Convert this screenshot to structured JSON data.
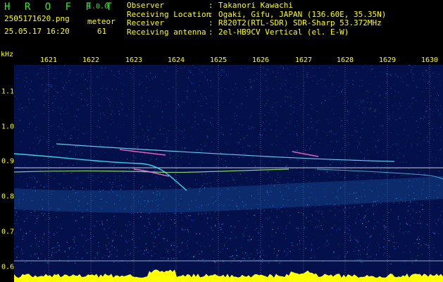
{
  "app": {
    "title": "H R O F F T",
    "version": "1.0.0"
  },
  "capture": {
    "filename": "2505171620.png",
    "datetime": "25.05.17 16:20",
    "meteor_label": "meteor",
    "meteor_count": "61"
  },
  "info": [
    {
      "key": "Observer",
      "sep": ":",
      "value": "Takanori Kawachi"
    },
    {
      "key": "Receiving Location",
      "sep": ":",
      "value": "Ogaki, Gifu, JAPAN (136.60E, 35.35N)"
    },
    {
      "key": "Receiver",
      "sep": ":",
      "value": "R820T2(RTL-SDR) SDR-Sharp 53.372MHz"
    },
    {
      "key": "Receiving antenna",
      "sep": ":",
      "value": "2el-HB9CV Vertical (el. E-W)"
    }
  ],
  "axis": {
    "y_unit": "kHz",
    "x_ticks": [
      "1621",
      "1622",
      "1623",
      "1624",
      "1625",
      "1626",
      "1627",
      "1628",
      "1629",
      "1630"
    ],
    "y_ticks": [
      "1.1",
      "1.0",
      "0.9",
      "0.8",
      "0.7",
      "0.6"
    ],
    "x_range": [
      1620.5,
      1630
    ],
    "y_range": [
      0.58,
      1.14
    ]
  },
  "colors": {
    "app_title": "#39e639",
    "label_text": "#ffff00",
    "background": "#000000",
    "spectrogram_bg": "#04104a",
    "carrier_line": "#ffffff",
    "echo_trail": "#ff66cc",
    "noise_floor": "#ffff00"
  }
}
